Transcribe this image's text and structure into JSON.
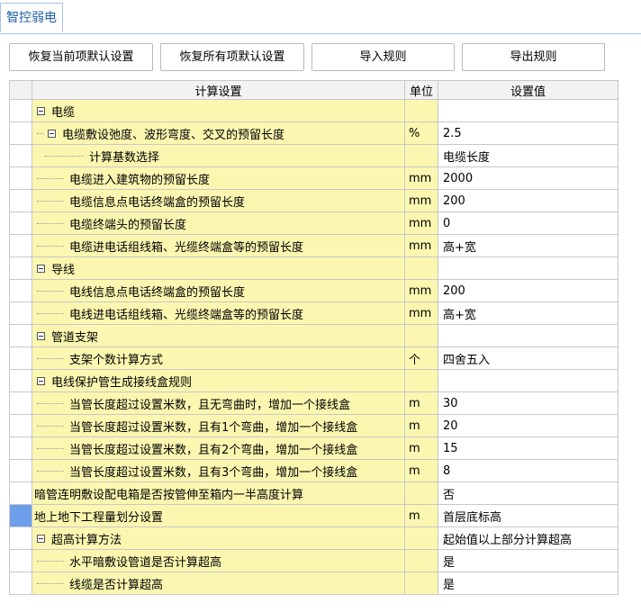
{
  "tab": {
    "label": "智控弱电"
  },
  "toolbar": {
    "restore_current": "恢复当前项默认设置",
    "restore_all": "恢复所有项默认设置",
    "import": "导入规则",
    "export": "导出规则"
  },
  "columns": {
    "name": "计算设置",
    "unit": "单位",
    "value": "设置值"
  },
  "rows": [
    {
      "level": 0,
      "group": true,
      "name": "电缆",
      "unit": "",
      "value": ""
    },
    {
      "level": 1,
      "group": true,
      "name": "电缆敷设弛度、波形弯度、交叉的预留长度",
      "unit": "%",
      "value": "2.5"
    },
    {
      "level": 2,
      "group": false,
      "name": "计算基数选择",
      "unit": "",
      "value": "电缆长度"
    },
    {
      "level": 1,
      "group": false,
      "name": "电缆进入建筑物的预留长度",
      "unit": "mm",
      "value": "2000"
    },
    {
      "level": 1,
      "group": false,
      "name": "电缆信息点电话终端盒的预留长度",
      "unit": "mm",
      "value": "200"
    },
    {
      "level": 1,
      "group": false,
      "name": "电缆终端头的预留长度",
      "unit": "mm",
      "value": "0"
    },
    {
      "level": 1,
      "group": false,
      "name": "电缆进电话组线箱、光缆终端盒等的预留长度",
      "unit": "mm",
      "value": "高+宽"
    },
    {
      "level": 0,
      "group": true,
      "name": "导线",
      "unit": "",
      "value": ""
    },
    {
      "level": 1,
      "group": false,
      "name": "电线信息点电话终端盒的预留长度",
      "unit": "mm",
      "value": "200"
    },
    {
      "level": 1,
      "group": false,
      "name": "电线进电话组线箱、光缆终端盒等的预留长度",
      "unit": "mm",
      "value": "高+宽"
    },
    {
      "level": 0,
      "group": true,
      "name": "管道支架",
      "unit": "",
      "value": ""
    },
    {
      "level": 1,
      "group": false,
      "name": "支架个数计算方式",
      "unit": "个",
      "value": "四舍五入"
    },
    {
      "level": 0,
      "group": true,
      "name": "电线保护管生成接线盒规则",
      "unit": "",
      "value": ""
    },
    {
      "level": 1,
      "group": false,
      "name": "当管长度超过设置米数，且无弯曲时，增加一个接线盒",
      "unit": "m",
      "value": "30"
    },
    {
      "level": 1,
      "group": false,
      "name": "当管长度超过设置米数，且有1个弯曲，增加一个接线盒",
      "unit": "m",
      "value": "20"
    },
    {
      "level": 1,
      "group": false,
      "name": "当管长度超过设置米数，且有2个弯曲，增加一个接线盒",
      "unit": "m",
      "value": "15"
    },
    {
      "level": 1,
      "group": false,
      "name": "当管长度超过设置米数，且有3个弯曲，增加一个接线盒",
      "unit": "m",
      "value": "8"
    },
    {
      "level": -1,
      "group": false,
      "name": "暗管连明敷设配电箱是否按管伸至箱内一半高度计算",
      "unit": "",
      "value": "否"
    },
    {
      "level": -1,
      "group": false,
      "name": "地上地下工程量划分设置",
      "unit": "m",
      "value": "首层底标高",
      "selected": true
    },
    {
      "level": 0,
      "group": true,
      "name": "超高计算方法",
      "unit": "",
      "value": "起始值以上部分计算超高"
    },
    {
      "level": 1,
      "group": false,
      "name": "水平暗敷设管道是否计算超高",
      "unit": "",
      "value": "是"
    },
    {
      "level": 1,
      "group": false,
      "name": "线缆是否计算超高",
      "unit": "",
      "value": "是"
    }
  ]
}
